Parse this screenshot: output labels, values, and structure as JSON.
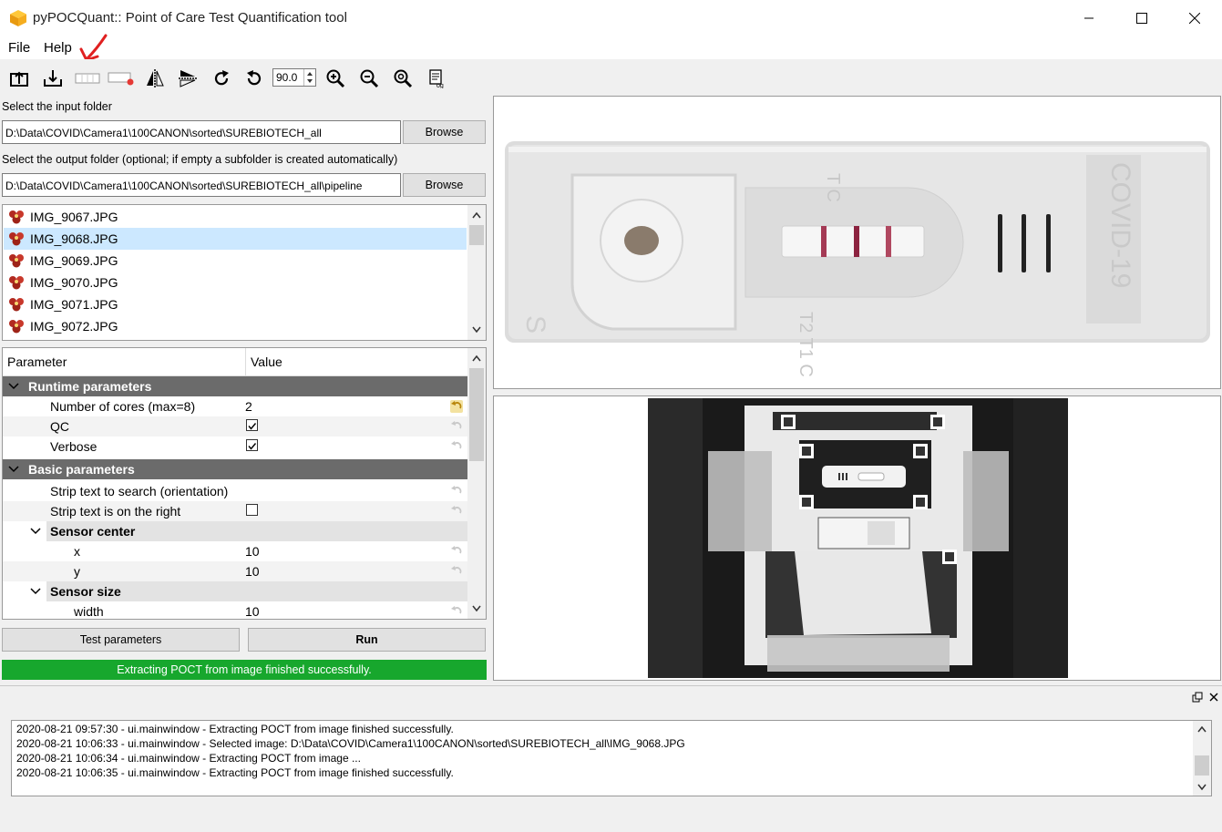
{
  "window": {
    "title": "pyPOCQuant:: Point of Care Test Quantification tool"
  },
  "menu": {
    "items": [
      "File",
      "Help"
    ]
  },
  "toolbar": {
    "rotation_value": "90.0"
  },
  "input_folder": {
    "label": "Select the input folder",
    "value": "D:\\Data\\COVID\\Camera1\\100CANON\\sorted\\SUREBIOTECH_all",
    "browse_label": "Browse"
  },
  "output_folder": {
    "label": "Select the output folder (optional; if empty a subfolder is created automatically)",
    "value": "D:\\Data\\COVID\\Camera1\\100CANON\\sorted\\SUREBIOTECH_all\\pipeline",
    "browse_label": "Browse"
  },
  "files": {
    "items": [
      "IMG_9067.JPG",
      "IMG_9068.JPG",
      "IMG_9069.JPG",
      "IMG_9070.JPG",
      "IMG_9071.JPG",
      "IMG_9072.JPG"
    ],
    "selected": "IMG_9068.JPG"
  },
  "params": {
    "header_param": "Parameter",
    "header_value": "Value",
    "runtime_group": "Runtime parameters",
    "cores_label": "Number of cores (max=8)",
    "cores_value": "2",
    "qc_label": "QC",
    "qc_checked": true,
    "verbose_label": "Verbose",
    "verbose_checked": true,
    "basic_group": "Basic parameters",
    "strip_text_label": "Strip text to search (orientation)",
    "strip_right_label": "Strip text is on the right",
    "strip_right_checked": false,
    "sensor_center_label": "Sensor center",
    "x_label": "x",
    "x_value": "10",
    "y_label": "y",
    "y_value": "10",
    "sensor_size_label": "Sensor size",
    "width_label": "width",
    "width_value": "10"
  },
  "actions": {
    "test_label": "Test parameters",
    "run_label": "Run"
  },
  "status": {
    "message": "Extracting POCT from image finished successfully.",
    "color": "#17a72d"
  },
  "strip_image": {
    "top_labels": "T  C",
    "bottom_labels": "T2  T1  C",
    "left_letter": "S",
    "brand_text": "COVID-19"
  },
  "log": {
    "lines": [
      "2020-08-21 09:57:30 - ui.mainwindow - Extracting POCT from image finished successfully.",
      "2020-08-21 10:06:33 - ui.mainwindow - Selected image: D:\\Data\\COVID\\Camera1\\100CANON\\sorted\\SUREBIOTECH_all\\IMG_9068.JPG",
      "2020-08-21 10:06:34 - ui.mainwindow - Extracting POCT from image ...",
      "2020-08-21 10:06:35 - ui.mainwindow - Extracting POCT from image finished successfully."
    ]
  }
}
